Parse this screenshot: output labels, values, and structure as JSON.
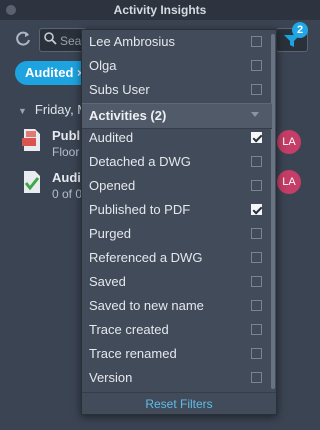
{
  "window": {
    "title": "Activity Insights"
  },
  "toolbar": {
    "search_placeholder": "Search",
    "filter_count": "2"
  },
  "chip": {
    "label": "Audited",
    "close": "×"
  },
  "list": {
    "date": "Friday, M",
    "rows": [
      {
        "name": "Publi",
        "sub": "Floor",
        "avatar": "LA"
      },
      {
        "name": "Audit",
        "sub": "0 of 0",
        "avatar": "LA"
      }
    ]
  },
  "dropdown": {
    "users": [
      {
        "label": "Lee Ambrosius",
        "checked": false
      },
      {
        "label": "Olga",
        "checked": false
      },
      {
        "label": "Subs User",
        "checked": false
      }
    ],
    "section_label": "Activities (2)",
    "activities": [
      {
        "label": "Audited",
        "checked": true
      },
      {
        "label": "Detached a DWG",
        "checked": false
      },
      {
        "label": "Opened",
        "checked": false
      },
      {
        "label": "Published to PDF",
        "checked": true
      },
      {
        "label": "Purged",
        "checked": false
      },
      {
        "label": "Referenced a DWG",
        "checked": false
      },
      {
        "label": "Saved",
        "checked": false
      },
      {
        "label": "Saved to new name",
        "checked": false
      },
      {
        "label": "Trace created",
        "checked": false
      },
      {
        "label": "Trace renamed",
        "checked": false
      },
      {
        "label": "Version",
        "checked": false
      }
    ],
    "reset_label": "Reset Filters"
  },
  "colors": {
    "accent": "#1da3e0",
    "avatar": "#c43e67",
    "background": "#3b4453"
  }
}
